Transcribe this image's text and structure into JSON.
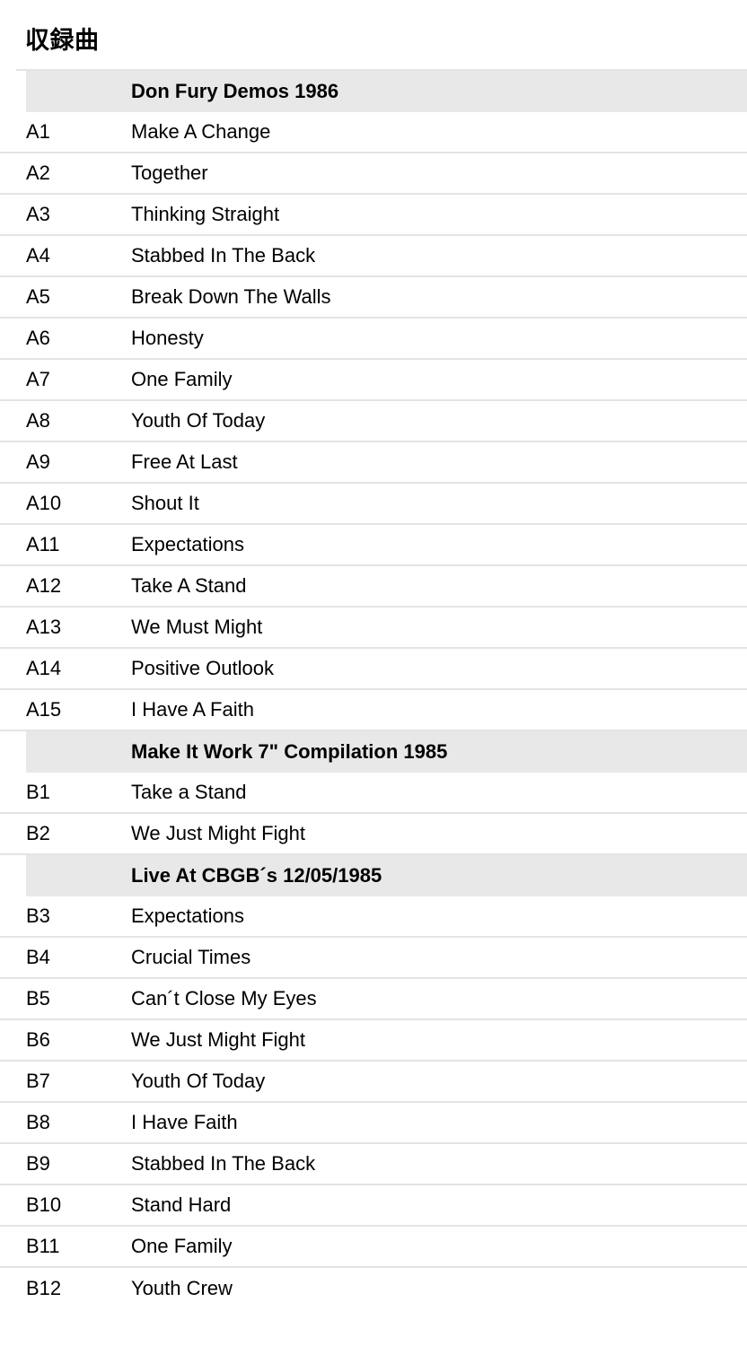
{
  "page": {
    "title": "収録曲"
  },
  "tracklist": {
    "rows": [
      {
        "kind": "section",
        "label": "Don Fury Demos 1986"
      },
      {
        "kind": "track",
        "pos": "A1",
        "title": "Make A Change"
      },
      {
        "kind": "track",
        "pos": "A2",
        "title": "Together"
      },
      {
        "kind": "track",
        "pos": "A3",
        "title": "Thinking Straight"
      },
      {
        "kind": "track",
        "pos": "A4",
        "title": "Stabbed In The Back"
      },
      {
        "kind": "track",
        "pos": "A5",
        "title": "Break Down The Walls"
      },
      {
        "kind": "track",
        "pos": "A6",
        "title": "Honesty"
      },
      {
        "kind": "track",
        "pos": "A7",
        "title": "One Family"
      },
      {
        "kind": "track",
        "pos": "A8",
        "title": "Youth Of Today"
      },
      {
        "kind": "track",
        "pos": "A9",
        "title": "Free At Last"
      },
      {
        "kind": "track",
        "pos": "A10",
        "title": "Shout It"
      },
      {
        "kind": "track",
        "pos": "A11",
        "title": "Expectations"
      },
      {
        "kind": "track",
        "pos": "A12",
        "title": "Take A Stand"
      },
      {
        "kind": "track",
        "pos": "A13",
        "title": "We Must Might"
      },
      {
        "kind": "track",
        "pos": "A14",
        "title": "Positive Outlook"
      },
      {
        "kind": "track",
        "pos": "A15",
        "title": "I Have A Faith"
      },
      {
        "kind": "section",
        "label": "Make It Work 7\" Compilation 1985"
      },
      {
        "kind": "track",
        "pos": "B1",
        "title": "Take a Stand"
      },
      {
        "kind": "track",
        "pos": "B2",
        "title": "We Just Might Fight"
      },
      {
        "kind": "section",
        "label": "Live At CBGB´s 12/05/1985"
      },
      {
        "kind": "track",
        "pos": "B3",
        "title": "Expectations"
      },
      {
        "kind": "track",
        "pos": "B4",
        "title": "Crucial Times"
      },
      {
        "kind": "track",
        "pos": "B5",
        "title": "Can´t Close My Eyes"
      },
      {
        "kind": "track",
        "pos": "B6",
        "title": "We Just Might Fight"
      },
      {
        "kind": "track",
        "pos": "B7",
        "title": "Youth Of Today"
      },
      {
        "kind": "track",
        "pos": "B8",
        "title": "I Have Faith"
      },
      {
        "kind": "track",
        "pos": "B9",
        "title": "Stabbed In The Back"
      },
      {
        "kind": "track",
        "pos": "B10",
        "title": "Stand Hard"
      },
      {
        "kind": "track",
        "pos": "B11",
        "title": "One Family"
      },
      {
        "kind": "track",
        "pos": "B12",
        "title": "Youth Crew"
      }
    ]
  },
  "colors": {
    "section_background": "#e8e8e8",
    "divider": "#e4e4e4",
    "text": "#000000",
    "page_background": "#ffffff"
  }
}
